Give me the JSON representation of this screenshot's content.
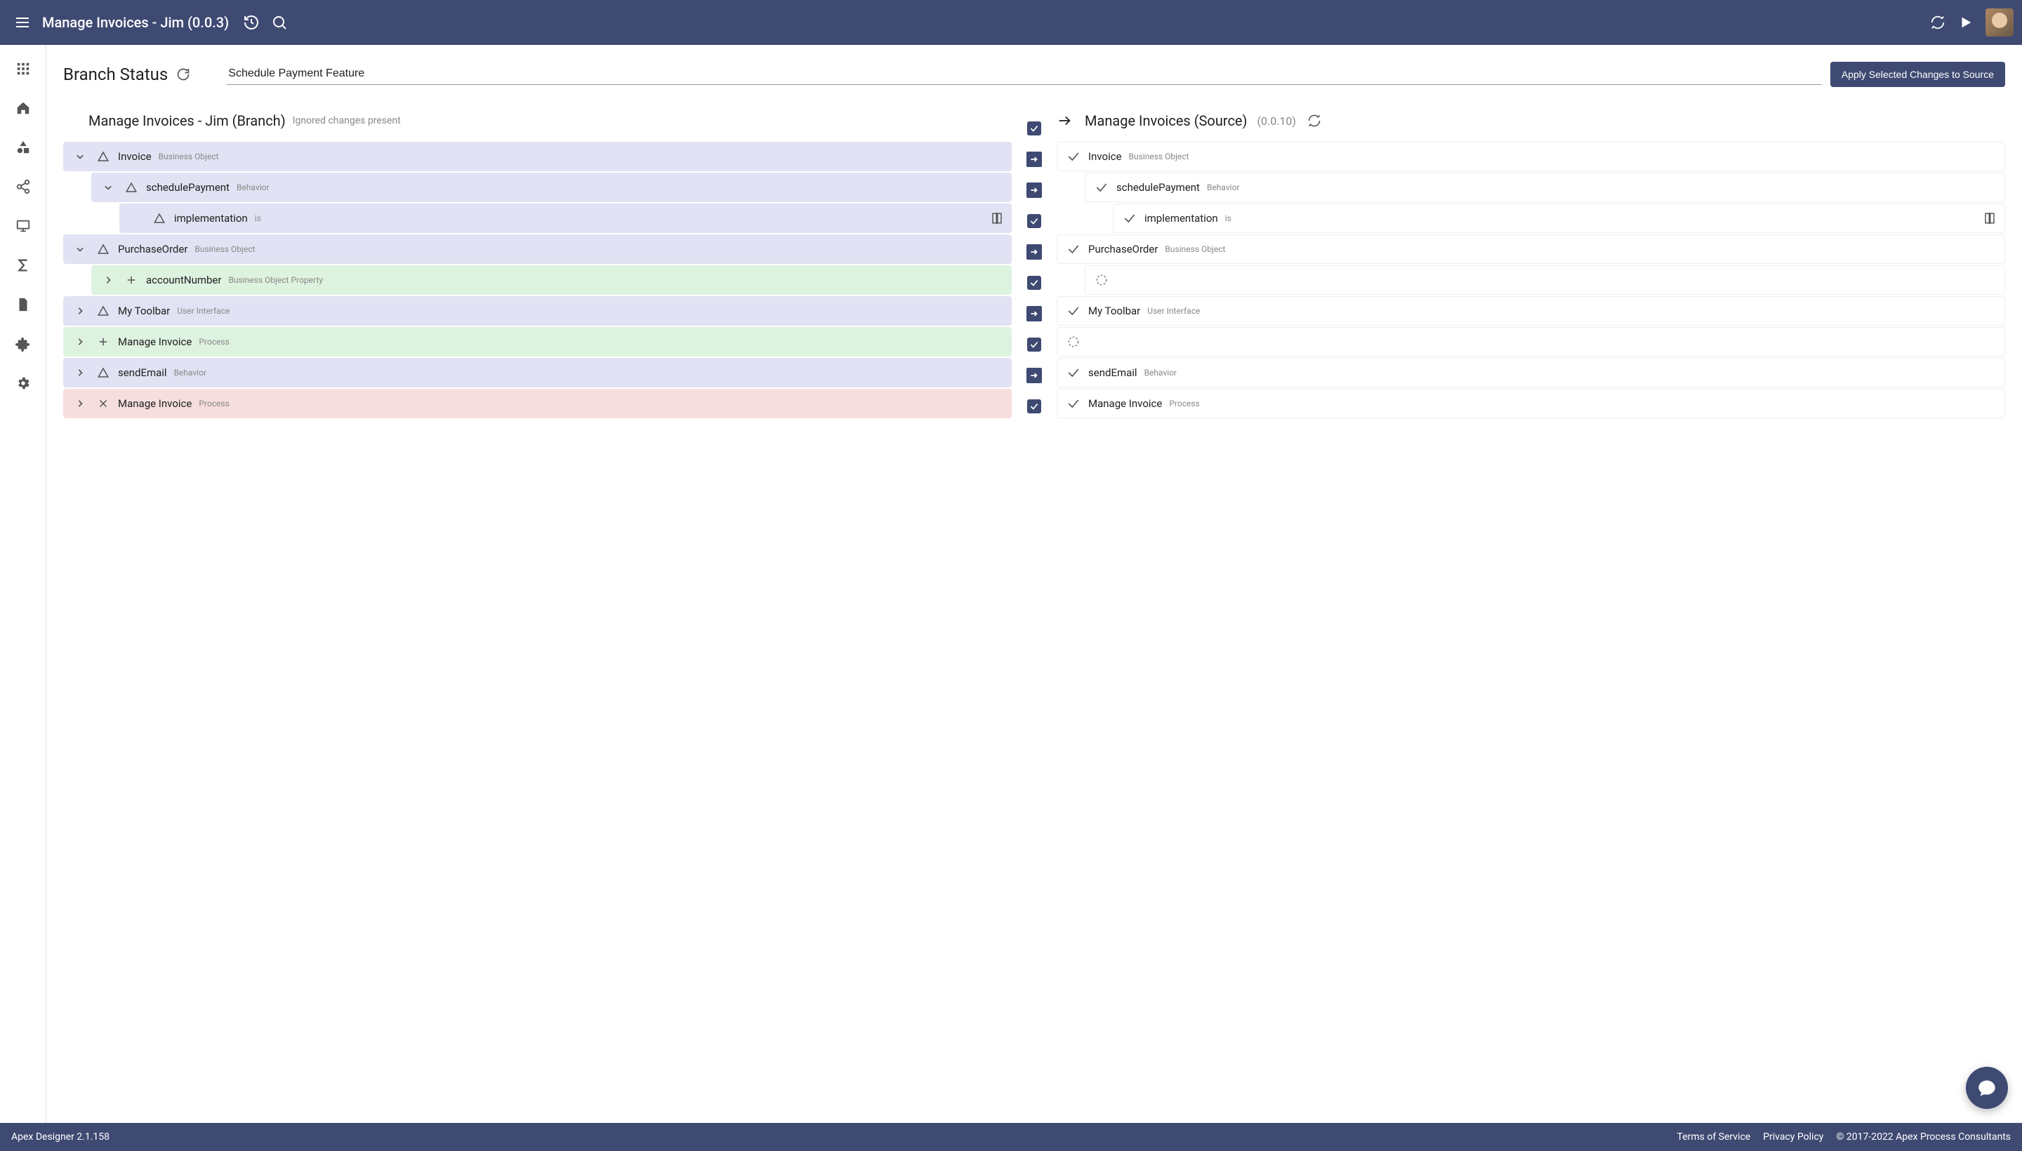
{
  "topbar": {
    "title": "Manage Invoices - Jim (0.0.3)"
  },
  "page": {
    "heading": "Branch Status",
    "branch_name": "Schedule Payment Feature",
    "apply_label": "Apply Selected Changes to Source"
  },
  "branch_col": {
    "title": "Manage Invoices - Jim (Branch)",
    "note": "Ignored changes present"
  },
  "source_col": {
    "title": "Manage Invoices (Source)",
    "version": "(0.0.10)"
  },
  "branch_items": [
    {
      "name": "Invoice",
      "type": "Business Object",
      "status": "changed",
      "indent": 0,
      "expanded": true,
      "compare": false
    },
    {
      "name": "schedulePayment",
      "type": "Behavior",
      "status": "changed",
      "indent": 1,
      "expanded": true,
      "compare": false
    },
    {
      "name": "implementation",
      "type": "is",
      "status": "changed",
      "indent": 2,
      "expanded": null,
      "compare": true
    },
    {
      "name": "PurchaseOrder",
      "type": "Business Object",
      "status": "changed",
      "indent": 0,
      "expanded": true,
      "compare": false
    },
    {
      "name": "accountNumber",
      "type": "Business Object Property",
      "status": "added",
      "indent": 1,
      "expanded": false,
      "compare": false
    },
    {
      "name": "My Toolbar",
      "type": "User Interface",
      "status": "changed",
      "indent": 0,
      "expanded": false,
      "compare": false
    },
    {
      "name": "Manage Invoice",
      "type": "Process",
      "status": "added",
      "indent": 0,
      "expanded": false,
      "compare": false
    },
    {
      "name": "sendEmail",
      "type": "Behavior",
      "status": "changed",
      "indent": 0,
      "expanded": false,
      "compare": false
    },
    {
      "name": "Manage Invoice",
      "type": "Process",
      "status": "deleted",
      "indent": 0,
      "expanded": false,
      "compare": false
    }
  ],
  "middle": [
    "arrow",
    "arrow",
    "check",
    "arrow",
    "check",
    "arrow",
    "check",
    "arrow",
    "check"
  ],
  "source_items": [
    {
      "name": "Invoice",
      "type": "Business Object",
      "status": "ok",
      "indent": 0,
      "compare": false
    },
    {
      "name": "schedulePayment",
      "type": "Behavior",
      "status": "ok",
      "indent": 1,
      "compare": false
    },
    {
      "name": "implementation",
      "type": "is",
      "status": "ok",
      "indent": 2,
      "compare": true
    },
    {
      "name": "PurchaseOrder",
      "type": "Business Object",
      "status": "ok",
      "indent": 0,
      "compare": false
    },
    {
      "name": "",
      "type": "",
      "status": "placeholder",
      "indent": 1,
      "compare": false
    },
    {
      "name": "My Toolbar",
      "type": "User Interface",
      "status": "ok",
      "indent": 0,
      "compare": false
    },
    {
      "name": "",
      "type": "",
      "status": "placeholder",
      "indent": 0,
      "compare": false
    },
    {
      "name": "sendEmail",
      "type": "Behavior",
      "status": "ok",
      "indent": 0,
      "compare": false
    },
    {
      "name": "Manage Invoice",
      "type": "Process",
      "status": "ok",
      "indent": 0,
      "compare": false
    }
  ],
  "footer": {
    "product": "Apex Designer 2.1.158",
    "terms": "Terms of Service",
    "privacy": "Privacy Policy",
    "copyright": "© 2017-2022 Apex Process Consultants"
  }
}
